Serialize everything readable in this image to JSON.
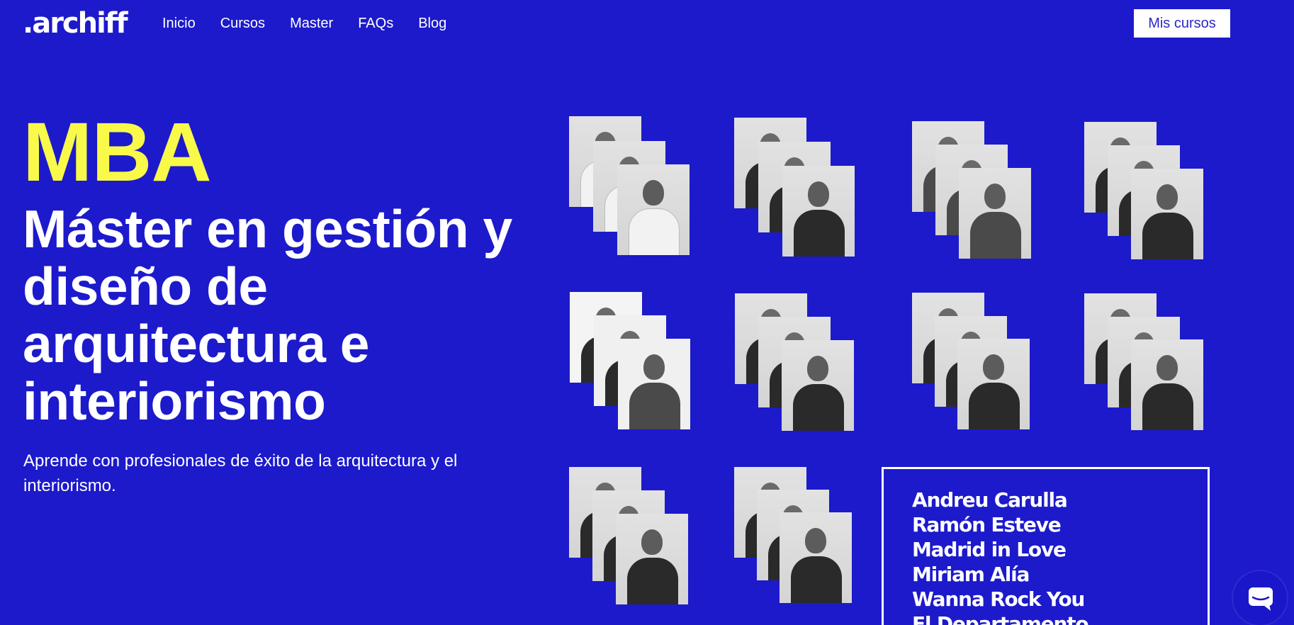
{
  "header": {
    "logo": ".archiff",
    "nav": [
      "Inicio",
      "Cursos",
      "Master",
      "FAQs",
      "Blog"
    ],
    "cta": "Mis cursos"
  },
  "hero": {
    "badge": "MBA",
    "title": "Máster en gestión y diseño de arquitectura e interiorismo",
    "subtitle": "Aprende con profesionales de éxito de la arquitectura y el interiorismo."
  },
  "instructors": [
    "Andreu Carulla",
    "Ramón Esteve",
    "Madrid in Love",
    "Miriam Alía",
    "Wanna Rock You",
    "El Departamento"
  ],
  "icons": {
    "chat": "chat-bubble-icon"
  },
  "colors": {
    "background": "#1c1acb",
    "accent": "#f9f94a",
    "text": "#ffffff"
  }
}
